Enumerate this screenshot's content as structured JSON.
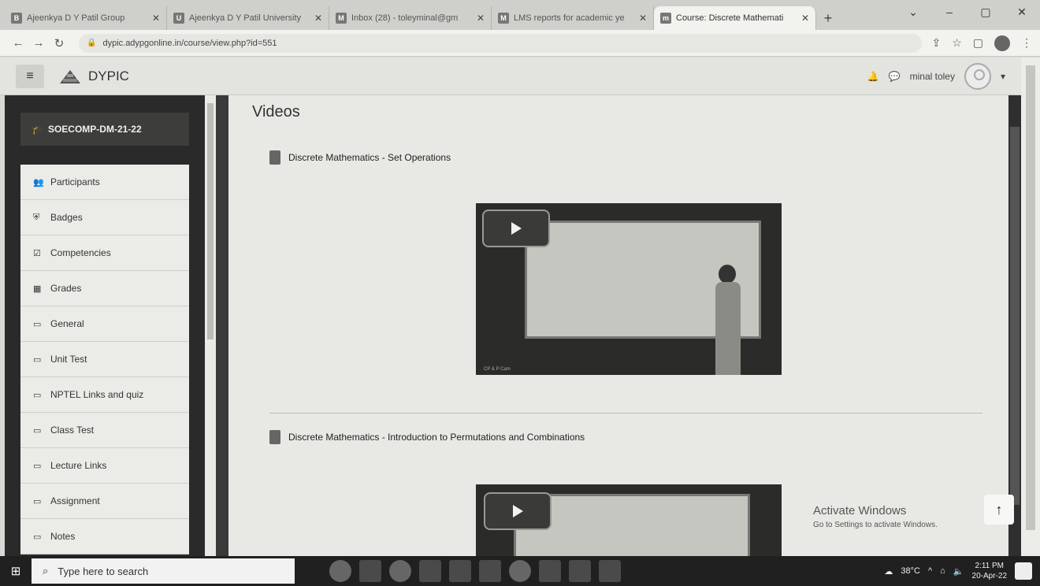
{
  "browser": {
    "tabs": [
      {
        "label": "Ajeenkya D Y Patil Group",
        "active": false
      },
      {
        "label": "Ajeenkya D Y Patil University",
        "active": false
      },
      {
        "label": "Inbox (28) - toleyminal@gm",
        "active": false
      },
      {
        "label": "LMS reports for academic ye",
        "active": false
      },
      {
        "label": "Course: Discrete Mathemati",
        "active": true
      }
    ],
    "url": "dypic.adypgonline.in/course/view.php?id=551"
  },
  "navbar": {
    "brand": "DYPIC",
    "user_name": "minal toley"
  },
  "drawer": {
    "course_short": "SOECOMP-DM-21-22",
    "items": [
      {
        "label": "Participants",
        "icon": "users-icon"
      },
      {
        "label": "Badges",
        "icon": "shield-icon"
      },
      {
        "label": "Competencies",
        "icon": "checkbox-icon"
      },
      {
        "label": "Grades",
        "icon": "table-icon"
      },
      {
        "label": "General",
        "icon": "folder-icon"
      },
      {
        "label": "Unit Test",
        "icon": "folder-icon"
      },
      {
        "label": "NPTEL Links and quiz",
        "icon": "folder-icon"
      },
      {
        "label": "Class Test",
        "icon": "folder-icon"
      },
      {
        "label": "Lecture Links",
        "icon": "folder-icon"
      },
      {
        "label": "Assignment",
        "icon": "folder-icon"
      },
      {
        "label": "Notes",
        "icon": "folder-icon"
      }
    ]
  },
  "main": {
    "section_title": "Videos",
    "activities": [
      {
        "title": "Discrete Mathematics - Set Operations"
      },
      {
        "title": "Discrete Mathematics - Introduction to Permutations and Combinations"
      }
    ],
    "video_caption": "CP & P Cam"
  },
  "watermark": {
    "line1": "Activate Windows",
    "line2": "Go to Settings to activate Windows."
  },
  "taskbar": {
    "search_placeholder": "Type here to search",
    "weather": "38°C",
    "time": "2:11 PM",
    "date": "20-Apr-22"
  }
}
